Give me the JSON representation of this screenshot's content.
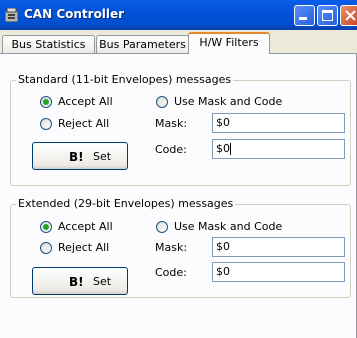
{
  "window": {
    "title": "CAN Controller"
  },
  "tabs": [
    {
      "label": "Bus Statistics"
    },
    {
      "label": "Bus Parameters"
    },
    {
      "label": "H/W Filters"
    }
  ],
  "standard": {
    "title": "Standard (11-bit Envelopes) messages",
    "accept_all": "Accept All",
    "reject_all": "Reject All",
    "use_mask": "Use Mask and Code",
    "mask_label": "Mask:",
    "mask_value": "$0",
    "code_label": "Code:",
    "code_value": "$0",
    "set_glyph": "B!",
    "set_label": "Set",
    "selected": "accept_all"
  },
  "extended": {
    "title": "Extended (29-bit Envelopes) messages",
    "accept_all": "Accept All",
    "reject_all": "Reject All",
    "use_mask": "Use Mask and Code",
    "mask_label": "Mask:",
    "mask_value": "$0",
    "code_label": "Code:",
    "code_value": "$0",
    "set_glyph": "B!",
    "set_label": "Set",
    "selected": "accept_all"
  },
  "colors": {
    "titlebar": "#0352d9",
    "tab_highlight": "#e68b2c",
    "radio_selected": "#22a322",
    "face": "#ece9d8"
  },
  "icons": {
    "app": "can-controller-icon",
    "minimize": "minimize-icon",
    "maximize": "maximize-icon",
    "close": "close-icon",
    "set": "set-icon"
  }
}
